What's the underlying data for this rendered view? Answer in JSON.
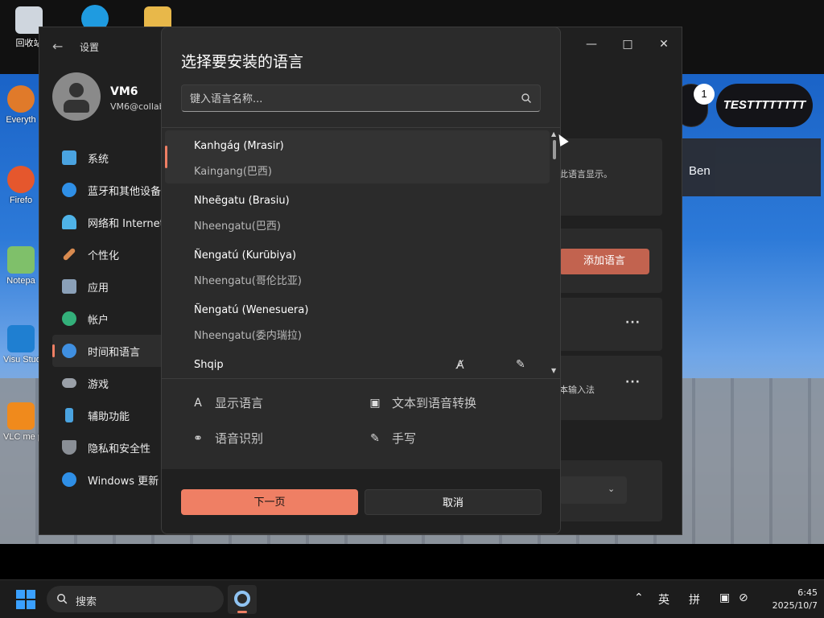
{
  "desktop": {
    "icons": [
      {
        "label": "回收站"
      },
      {
        "label": "Everyth"
      },
      {
        "label": "Firefo"
      },
      {
        "label": "Notepa"
      },
      {
        "label": "Visu Studio"
      },
      {
        "label": "VLC me playe"
      }
    ],
    "roblox": {
      "badge_count": "1",
      "username": "TESTTTTTTTT",
      "panel_text": "Ben"
    }
  },
  "settings": {
    "title": "设置",
    "profile": {
      "name": "VM6",
      "email": "VM6@collab"
    },
    "nav": [
      {
        "label": "系统",
        "icon": "monitor-icon",
        "color": "#4aa3e0"
      },
      {
        "label": "蓝牙和其他设备",
        "icon": "bluetooth-icon",
        "color": "#2f8fe6"
      },
      {
        "label": "网络和 Internet",
        "icon": "wifi-icon",
        "color": "#4fb3e8"
      },
      {
        "label": "个性化",
        "icon": "brush-icon",
        "color": "#d88a4f"
      },
      {
        "label": "应用",
        "icon": "apps-icon",
        "color": "#8aa0b8"
      },
      {
        "label": "帐户",
        "icon": "account-icon",
        "color": "#33b07a"
      },
      {
        "label": "时间和语言",
        "icon": "globe-clock-icon",
        "color": "#3f8fe0",
        "active": true
      },
      {
        "label": "游戏",
        "icon": "gamepad-icon",
        "color": "#9aa0a8"
      },
      {
        "label": "辅助功能",
        "icon": "accessibility-icon",
        "color": "#4aa3e0"
      },
      {
        "label": "隐私和安全性",
        "icon": "shield-icon",
        "color": "#8a8f96"
      },
      {
        "label": "Windows 更新",
        "icon": "update-icon",
        "color": "#2f8fe6"
      }
    ],
    "right_pane": {
      "text_fragment_1": "此语言显示。",
      "add_language_label": "添加语言",
      "text_fragment_2": "本输入法",
      "more_label": "···"
    }
  },
  "dialog": {
    "title": "选择要安装的语言",
    "search_placeholder": "键入语言名称...",
    "languages": [
      {
        "name": "Kanhgág (Mrasir)",
        "sub": "Kaingang(巴西)",
        "selected": true
      },
      {
        "name": "Nheẽgatu (Brasiu)",
        "sub": "Nheengatu(巴西)"
      },
      {
        "name": "Ñengatú (Kurũbiya)",
        "sub": "Nheengatu(哥伦比亚)"
      },
      {
        "name": "Ñengatú (Wenesuera)",
        "sub": "Nheengatu(委内瑞拉)"
      },
      {
        "name": "Shqip",
        "sub": ""
      }
    ],
    "features": [
      {
        "label": "显示语言",
        "icon": "display-language-icon"
      },
      {
        "label": "文本到语音转换",
        "icon": "text-to-speech-icon"
      },
      {
        "label": "语音识别",
        "icon": "microphone-icon"
      },
      {
        "label": "手写",
        "icon": "handwriting-icon"
      }
    ],
    "next_label": "下一页",
    "cancel_label": "取消"
  },
  "taskbar": {
    "search_label": "搜索",
    "tray": {
      "ime_lang": "英",
      "ime_mode": "拼"
    },
    "time": "6:45",
    "date": "2025/10/7"
  },
  "colors": {
    "accent": "#ef7f64",
    "window_bg": "#202020",
    "dialog_bg": "#2b2b2b"
  }
}
